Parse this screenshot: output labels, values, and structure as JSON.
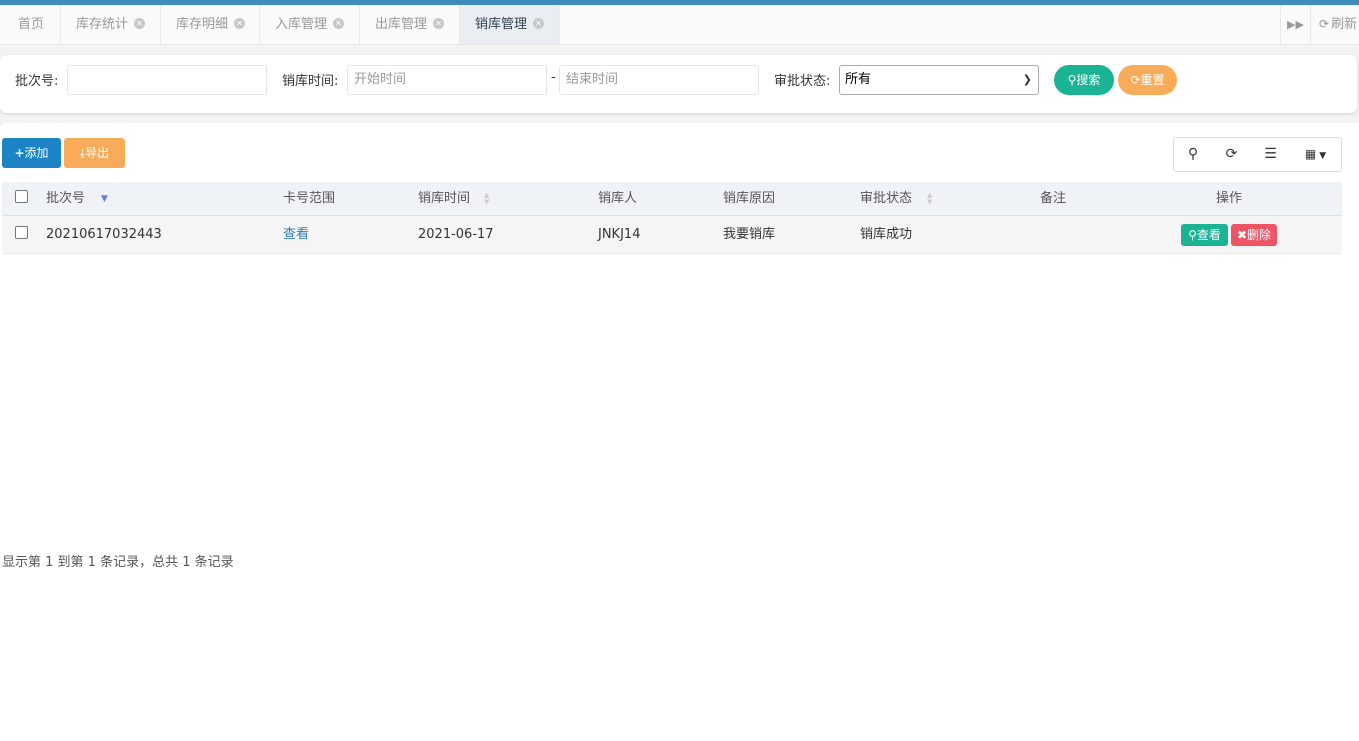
{
  "tabs": [
    {
      "label": "首页",
      "closable": false,
      "active": false
    },
    {
      "label": "库存统计",
      "closable": true,
      "active": false
    },
    {
      "label": "库存明细",
      "closable": true,
      "active": false
    },
    {
      "label": "入库管理",
      "closable": true,
      "active": false
    },
    {
      "label": "出库管理",
      "closable": true,
      "active": false
    },
    {
      "label": "销库管理",
      "closable": true,
      "active": true
    }
  ],
  "tab_tools": {
    "forward_icon": "double-chevron-right-icon",
    "refresh_label": "刷新"
  },
  "search": {
    "batch_label": "批次号:",
    "batch_value": "",
    "time_label": "销库时间:",
    "start_placeholder": "开始时间",
    "range_separator": "-",
    "end_placeholder": "结束时间",
    "status_label": "审批状态:",
    "status_selected": "所有",
    "search_button": "搜索",
    "reset_button": "重置"
  },
  "toolbar": {
    "add_label": "添加",
    "export_label": "导出"
  },
  "colors": {
    "accent": "#3c8dbc",
    "primary": "#1c84c6",
    "success": "#1ab394",
    "warning": "#f8ac59",
    "danger": "#ed5565",
    "link": "#337ab7"
  },
  "table": {
    "columns": [
      "批次号",
      "卡号范围",
      "销库时间",
      "销库人",
      "销库原因",
      "审批状态",
      "备注",
      "操作"
    ],
    "rows": [
      {
        "batch": "20210617032443",
        "card_range": "查看",
        "time": "2021-06-17",
        "operator": "JNKJ14",
        "reason": "我要销库",
        "status": "销库成功",
        "note": "",
        "view_label": "查看",
        "delete_label": "删除"
      }
    ]
  },
  "pagination": {
    "info": "显示第 1 到第 1 条记录，总共 1 条记录"
  }
}
